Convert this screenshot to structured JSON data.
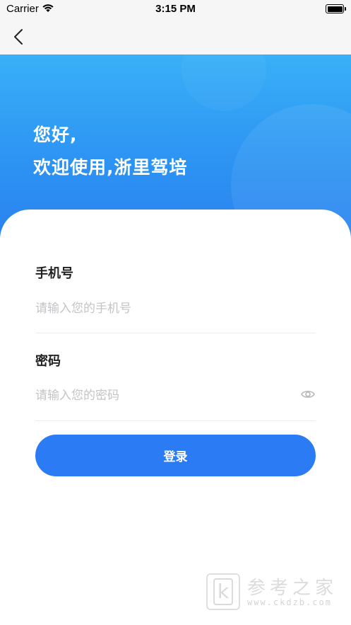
{
  "status_bar": {
    "carrier": "Carrier",
    "time": "3:15 PM",
    "icons": [
      "wifi-icon",
      "battery-icon"
    ]
  },
  "nav": {
    "back_icon": "chevron-left-icon"
  },
  "hero": {
    "line1": "您好,",
    "line2": "欢迎使用,浙里驾培"
  },
  "form": {
    "phone_label": "手机号",
    "phone_placeholder": "请输入您的手机号",
    "phone_value": "",
    "password_label": "密码",
    "password_placeholder": "请输入您的密码",
    "password_value": "",
    "eye_icon": "eye-icon",
    "login_label": "登录"
  },
  "watermark": {
    "logo_letter": "k",
    "title": "参考之家",
    "url": "www.ckdzb.com"
  },
  "colors": {
    "primary": "#2b7bf5",
    "hero_top": "#39b0f7",
    "hero_bottom": "#2a82ef",
    "placeholder": "#c4c4c8"
  }
}
